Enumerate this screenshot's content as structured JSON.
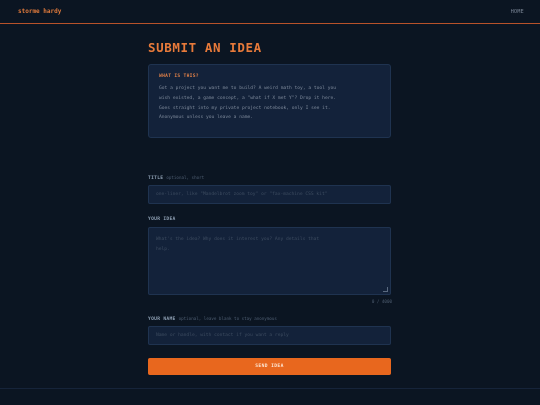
{
  "header": {
    "brand": "storme hardy",
    "nav_home": "HOME"
  },
  "main": {
    "title": "SUBMIT AN IDEA",
    "info": {
      "title": "WHAT IS THIS?",
      "lines": [
        "Got a project you want me to build? A weird math toy, a tool you",
        "wish existed, a game concept, a \"what if X met Y\"? Drop it here.",
        "Goes straight into my private project notebook, only I see it.",
        "Anonymous unless you leave a name."
      ]
    },
    "title_field": {
      "label": "TITLE",
      "hint": "optional, short",
      "placeholder": "one-liner, like \"Mandelbrot zoom toy\" or \"fax-machine CSS kit\""
    },
    "idea_field": {
      "label": "YOUR IDEA",
      "placeholder_lines": [
        "What's the idea? Why does it interest you? Any details that",
        "help."
      ],
      "counter": "0 / 4000"
    },
    "name_field": {
      "label": "YOUR NAME",
      "hint": "optional, leave blank to stay anonymous",
      "placeholder": "Name or handle, with contact if you want a reply"
    },
    "submit_label": "SEND IDEA"
  }
}
